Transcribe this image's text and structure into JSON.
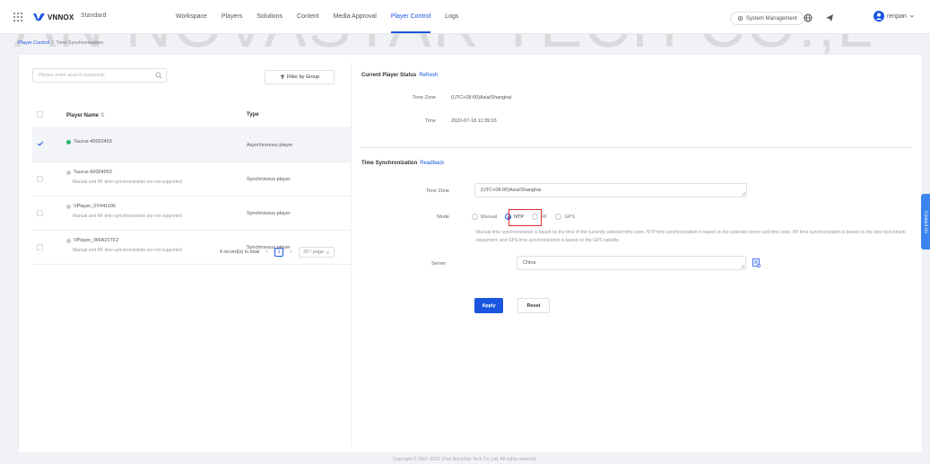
{
  "header": {
    "logo_text": "VNNOX",
    "edition": "Standard",
    "nav": [
      {
        "label": "Workspace",
        "active": false
      },
      {
        "label": "Players",
        "active": false
      },
      {
        "label": "Solutions",
        "active": false
      },
      {
        "label": "Content",
        "active": false
      },
      {
        "label": "Media Approval",
        "active": false
      },
      {
        "label": "Player Control",
        "active": true
      },
      {
        "label": "Logs",
        "active": false
      }
    ],
    "system_management": "System Management",
    "user_name": "renpan",
    "icons": [
      "apps-grid-icon",
      "settings-icon",
      "globe-icon",
      "send-icon",
      "user-avatar-icon",
      "chevron-down-icon"
    ]
  },
  "breadcrumb": {
    "parent": "Player Control",
    "separator": "/",
    "current": "Time Synchronization"
  },
  "player_list": {
    "search_placeholder": "Please enter search keywords",
    "filter_label": "Filter by Group",
    "columns": {
      "name": "Player Name",
      "sort_icon": "⇅",
      "type": "Type"
    },
    "rows": [
      {
        "name": "Taurus-40002453",
        "note": "",
        "type": "Asynchronous player",
        "status": "online",
        "selected": true
      },
      {
        "name": "Taurus-60004953",
        "note": "Manual and RF time synchronization are not supported",
        "type": "Synchronous player",
        "status": "offline",
        "selected": false
      },
      {
        "name": "VPlayer_0Y441106",
        "note": "Manual and RF time synchronization are not supported",
        "type": "Synchronous player",
        "status": "offline",
        "selected": false
      },
      {
        "name": "VPlayer_W9A15TF2",
        "note": "Manual and RF time synchronization are not supported",
        "type": "Synchronous player",
        "status": "offline",
        "selected": false
      }
    ],
    "pagination": {
      "total_text": "4 record(s) in total",
      "prev": "<",
      "page": "1",
      "next": ">",
      "page_size": "20 / page"
    }
  },
  "current_status": {
    "title": "Current Player Status",
    "refresh_link": "Refresh",
    "time_zone_label": "Time Zone",
    "time_zone_value": "(UTC+08:00)Asia/Shanghai",
    "time_label": "Time",
    "time_value": "2022-07-18 11:39:33"
  },
  "time_sync": {
    "title": "Time Synchronization",
    "readback_link": "Readback",
    "time_zone_label": "Time Zone",
    "time_zone_value": "(UTC+08:00)Asia/Shanghai",
    "mode_label": "Mode",
    "modes": [
      {
        "label": "Manual",
        "checked": false
      },
      {
        "label": "NTP",
        "checked": true
      },
      {
        "label": "RF",
        "checked": false
      },
      {
        "label": "GPS",
        "checked": false
      }
    ],
    "description": "Manual time synchronization is based on the time of the currently selected time zone, NTP time synchronization is based on the selected server and time zone, RF time synchronization is based on the time benchmark equipment, and GPS time synchronization is based on the GPS satellite.",
    "server_label": "Server",
    "server_value": "China",
    "apply_label": "Apply",
    "reset_label": "Reset"
  },
  "contact_tab": "Contact Us",
  "footer": "Copyright © 2007–2022 Xi'an NovaStar Tech Co.,Ltd. All rights reserved.",
  "watermark": "'AN NOVASTAR TECH CO.,L",
  "colors": {
    "accent": "#1a55e0",
    "online": "#2bb673",
    "highlight": "#e02a2a"
  }
}
